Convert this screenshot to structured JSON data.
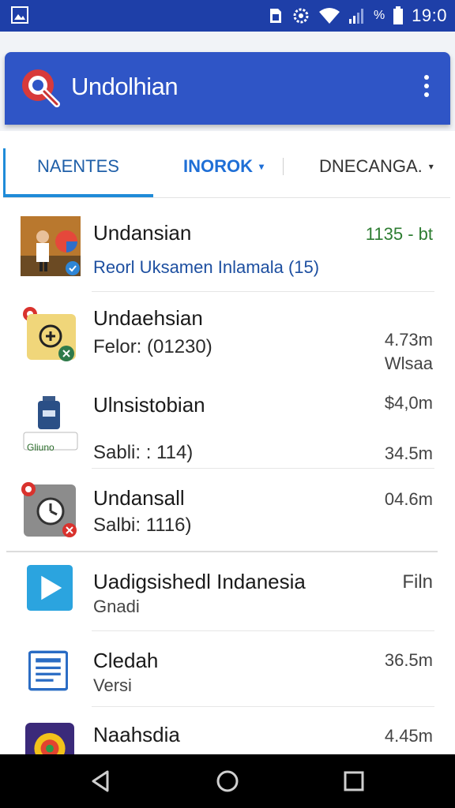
{
  "status_bar": {
    "percent": "%",
    "time": "19:0"
  },
  "app_bar": {
    "title": "Undolhian"
  },
  "tabs": [
    {
      "label": "NAENTES"
    },
    {
      "label": "INOROK"
    },
    {
      "label": "DNECANGA."
    }
  ],
  "list": [
    {
      "name": "Undansian",
      "sub": "Reorl Uksamen Inlamala (15)",
      "meta1": "1135 - bt",
      "meta2": ""
    },
    {
      "name": "Undaehsian",
      "sub": "Felor: (01230)",
      "meta1": "4.73m",
      "meta2": "Wlsaa"
    },
    {
      "name": "Ulnsistobian",
      "sub": "Sabli: : 114)",
      "meta1": "$4,0m",
      "meta2": "34.5m",
      "badge": "Gliuno"
    },
    {
      "name": "Undansall",
      "sub": "Salbi: 1116)",
      "meta1": "04.6m",
      "meta2": ""
    },
    {
      "name": "Uadigsishedl Indanesia",
      "sub": "Gnadi",
      "meta1": "Filn",
      "meta2": ""
    },
    {
      "name": "Cledah",
      "sub": "Versi",
      "meta1": "36.5m",
      "meta2": ""
    },
    {
      "name": "Naahsdia",
      "sub": "",
      "meta1": "4.45m",
      "meta2": ""
    }
  ],
  "colors": {
    "status_bar": "#1e3fa8",
    "app_bar": "#2f55c6",
    "tab_active": "#1f8bd8",
    "meta_green": "#2e7d32",
    "link_blue": "#1d4fa0"
  },
  "icons": {
    "status_left": "gallery-icon",
    "status_right": [
      "sim-icon",
      "settings-icon",
      "wifi-icon",
      "signal-icon",
      "battery-icon"
    ],
    "app_logo": "search-magnifier-icon",
    "nav": [
      "back-icon",
      "home-icon",
      "recents-icon"
    ]
  }
}
